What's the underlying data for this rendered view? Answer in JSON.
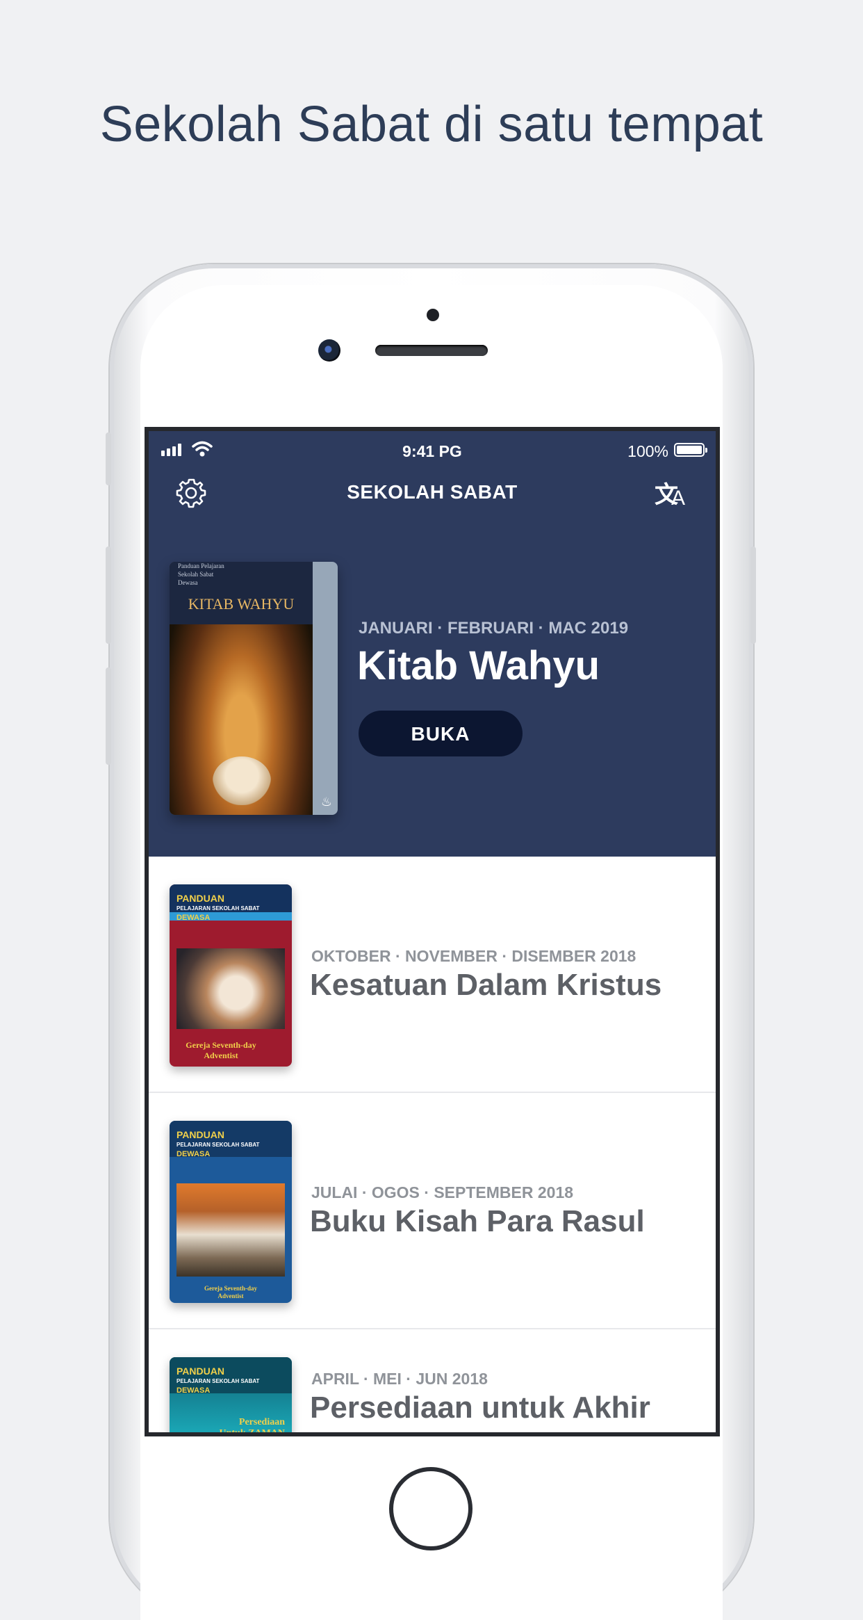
{
  "headline": "Sekolah Sabat di satu tempat",
  "status_bar": {
    "time": "9:41 PG",
    "battery": "100%"
  },
  "nav": {
    "title": "SEKOLAH SABAT",
    "settings_icon": "gear-icon",
    "language_icon": "translate-icon"
  },
  "featured": {
    "cover": {
      "small_lines": [
        "Panduan Pelajaran",
        "Sekolah Sabat",
        "Dewasa"
      ],
      "title": "KITAB WAHYU"
    },
    "period": "JANUARI · FEBRUARI · MAC 2019",
    "title": "Kitab Wahyu",
    "button_label": "BUKA"
  },
  "quarterlies": [
    {
      "period": "OKTOBER · NOVEMBER · DISEMBER 2018",
      "title": "Kesatuan Dalam Kristus",
      "cover": {
        "line1": "PANDUAN",
        "line2": "PELAJARAN SEKOLAH SABAT",
        "line3": "DEWASA",
        "footer": "Gereja Seventh-day Adventist",
        "color": "#9e1b2e"
      }
    },
    {
      "period": "JULAI · OGOS · SEPTEMBER 2018",
      "title": "Buku Kisah Para Rasul",
      "cover": {
        "line1": "PANDUAN",
        "line2": "PELAJARAN SEKOLAH SABAT",
        "line3": "DEWASA",
        "footer": "Gereja Seventh-day Adventist",
        "color": "#1d5a9a"
      }
    },
    {
      "period": "APRIL · MEI · JUN 2018",
      "title": "Persediaan untuk Akhir",
      "cover": {
        "line1": "PANDUAN",
        "line2": "PELAJARAN SEKOLAH SABAT",
        "line3": "DEWASA",
        "footer": "Persediaan Untuk ZAMAN AKHIR",
        "color": "#1aa4b3"
      }
    }
  ]
}
